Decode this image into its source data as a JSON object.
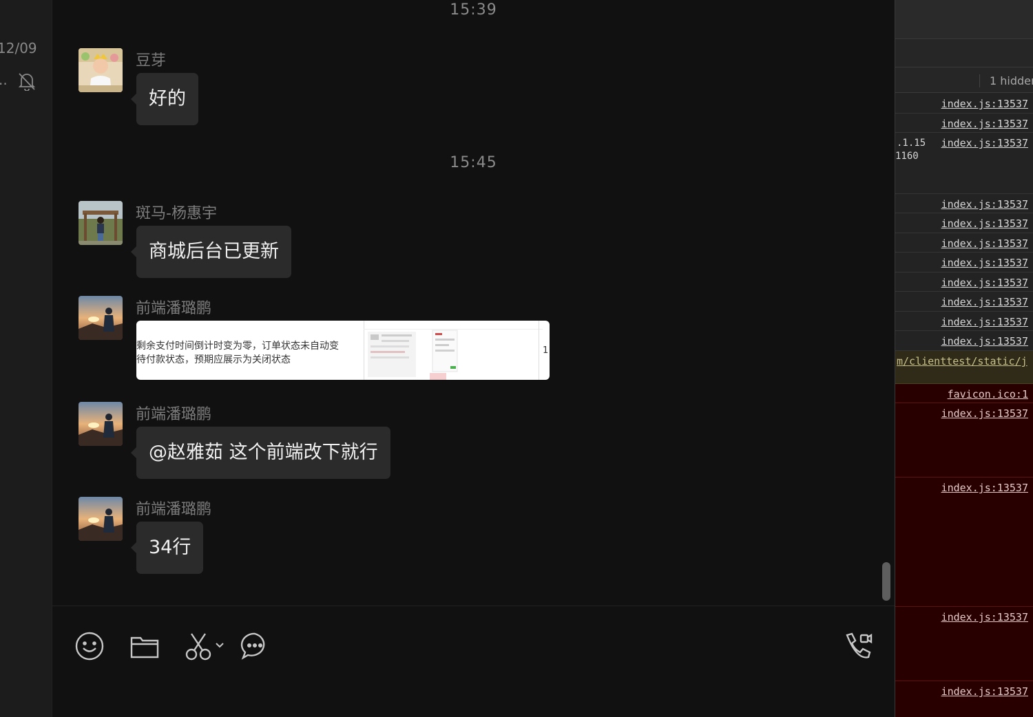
{
  "sidebar": {
    "date": "12/09",
    "ellipsis": "..",
    "mute_icon": "bell-off-icon"
  },
  "chat": {
    "time_1": "15:39",
    "time_2": "15:45",
    "messages": [
      {
        "sender": "豆芽",
        "text": "好的"
      },
      {
        "sender": "斑马-杨惠宇",
        "text": "商城后台已更新"
      },
      {
        "sender": "前端潘璐鹏",
        "image_text_1": "剩余支付时间倒计时变为零，订单状态未自动变",
        "image_text_2": "待付款状态，预期应展示为关闭状态",
        "image_number": "1"
      },
      {
        "sender": "前端潘璐鹏",
        "text": "@赵雅茹 这个前端改下就行"
      },
      {
        "sender": "前端潘璐鹏",
        "text": "34行"
      }
    ]
  },
  "composer": {
    "icons": [
      "emoji-icon",
      "folder-icon",
      "scissors-icon",
      "chat-history-icon",
      "call-icon"
    ]
  },
  "devtools": {
    "hidden_label": "1 hidder",
    "snippet_1": ".1.15",
    "snippet_2": "1160",
    "warning_link": "m/clienttest/static/j",
    "favicon_link": "favicon.ico:1",
    "links": [
      "index.js:13537",
      "index.js:13537",
      "index.js:13537",
      "index.js:13537",
      "index.js:13537",
      "index.js:13537",
      "index.js:13537",
      "index.js:13537",
      "index.js:13537",
      "index.js:13537",
      "index.js:13537",
      "index.js:13537",
      "index.js:13537",
      "index.js:13537",
      "index.js:13537"
    ]
  }
}
